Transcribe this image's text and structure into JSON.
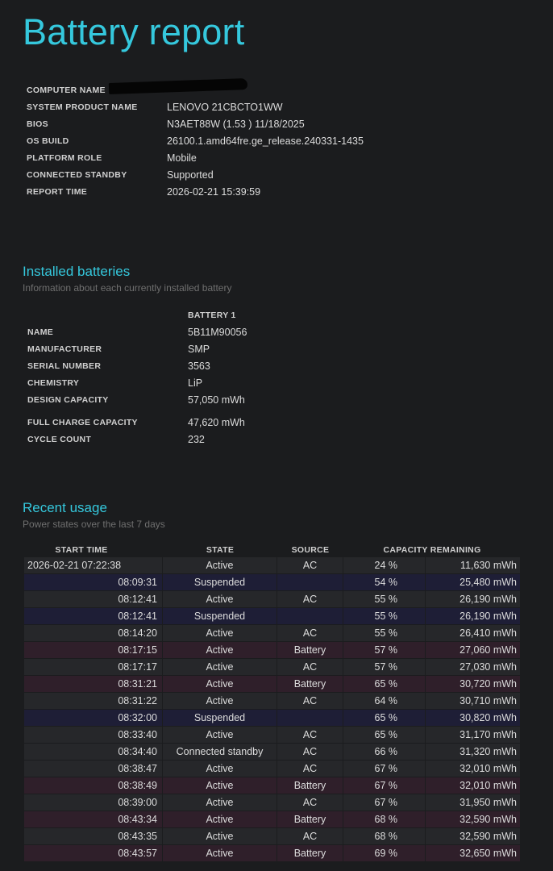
{
  "title": "Battery report",
  "system_info": [
    {
      "label": "COMPUTER NAME",
      "value": ""
    },
    {
      "label": "SYSTEM PRODUCT NAME",
      "value": "LENOVO 21CBCTO1WW"
    },
    {
      "label": "BIOS",
      "value": "N3AET88W (1.53 ) 11/18/2025"
    },
    {
      "label": "OS BUILD",
      "value": "26100.1.amd64fre.ge_release.240331-1435"
    },
    {
      "label": "PLATFORM ROLE",
      "value": "Mobile"
    },
    {
      "label": "CONNECTED STANDBY",
      "value": "Supported"
    },
    {
      "label": "REPORT TIME",
      "value": "2026-02-21  15:39:59"
    }
  ],
  "installed_batteries": {
    "heading": "Installed batteries",
    "subtitle": "Information about each currently installed battery",
    "column_header": "BATTERY 1",
    "rows": [
      {
        "label": "NAME",
        "value": "5B11M90056"
      },
      {
        "label": "MANUFACTURER",
        "value": "SMP"
      },
      {
        "label": "SERIAL NUMBER",
        "value": "3563"
      },
      {
        "label": "CHEMISTRY",
        "value": "LiP"
      },
      {
        "label": "DESIGN CAPACITY",
        "value": "57,050 mWh"
      }
    ],
    "rows2": [
      {
        "label": "FULL CHARGE CAPACITY",
        "value": "47,620 mWh"
      },
      {
        "label": "CYCLE COUNT",
        "value": "232"
      }
    ]
  },
  "recent_usage": {
    "heading": "Recent usage",
    "subtitle": "Power states over the last 7 days",
    "headers": {
      "start_time": "START TIME",
      "state": "STATE",
      "source": "SOURCE",
      "capacity": "CAPACITY REMAINING"
    },
    "rows": [
      {
        "start": "2026-02-21  07:22:38",
        "state": "Active",
        "source": "AC",
        "pct": "24 %",
        "mwh": "11,630 mWh",
        "kind": "ac"
      },
      {
        "start": "08:09:31",
        "state": "Suspended",
        "source": "",
        "pct": "54 %",
        "mwh": "25,480 mWh",
        "kind": "susp"
      },
      {
        "start": "08:12:41",
        "state": "Active",
        "source": "AC",
        "pct": "55 %",
        "mwh": "26,190 mWh",
        "kind": "ac"
      },
      {
        "start": "08:12:41",
        "state": "Suspended",
        "source": "",
        "pct": "55 %",
        "mwh": "26,190 mWh",
        "kind": "susp"
      },
      {
        "start": "08:14:20",
        "state": "Active",
        "source": "AC",
        "pct": "55 %",
        "mwh": "26,410 mWh",
        "kind": "ac"
      },
      {
        "start": "08:17:15",
        "state": "Active",
        "source": "Battery",
        "pct": "57 %",
        "mwh": "27,060 mWh",
        "kind": "batt"
      },
      {
        "start": "08:17:17",
        "state": "Active",
        "source": "AC",
        "pct": "57 %",
        "mwh": "27,030 mWh",
        "kind": "ac"
      },
      {
        "start": "08:31:21",
        "state": "Active",
        "source": "Battery",
        "pct": "65 %",
        "mwh": "30,720 mWh",
        "kind": "batt"
      },
      {
        "start": "08:31:22",
        "state": "Active",
        "source": "AC",
        "pct": "64 %",
        "mwh": "30,710 mWh",
        "kind": "ac"
      },
      {
        "start": "08:32:00",
        "state": "Suspended",
        "source": "",
        "pct": "65 %",
        "mwh": "30,820 mWh",
        "kind": "susp"
      },
      {
        "start": "08:33:40",
        "state": "Active",
        "source": "AC",
        "pct": "65 %",
        "mwh": "31,170 mWh",
        "kind": "ac"
      },
      {
        "start": "08:34:40",
        "state": "Connected standby",
        "source": "AC",
        "pct": "66 %",
        "mwh": "31,320 mWh",
        "kind": "ac"
      },
      {
        "start": "08:38:47",
        "state": "Active",
        "source": "AC",
        "pct": "67 %",
        "mwh": "32,010 mWh",
        "kind": "ac"
      },
      {
        "start": "08:38:49",
        "state": "Active",
        "source": "Battery",
        "pct": "67 %",
        "mwh": "32,010 mWh",
        "kind": "batt"
      },
      {
        "start": "08:39:00",
        "state": "Active",
        "source": "AC",
        "pct": "67 %",
        "mwh": "31,950 mWh",
        "kind": "ac"
      },
      {
        "start": "08:43:34",
        "state": "Active",
        "source": "Battery",
        "pct": "68 %",
        "mwh": "32,590 mWh",
        "kind": "batt"
      },
      {
        "start": "08:43:35",
        "state": "Active",
        "source": "AC",
        "pct": "68 %",
        "mwh": "32,590 mWh",
        "kind": "ac"
      },
      {
        "start": "08:43:57",
        "state": "Active",
        "source": "Battery",
        "pct": "69 %",
        "mwh": "32,650 mWh",
        "kind": "batt"
      }
    ]
  },
  "colors": {
    "accent": "#35c8dd",
    "background": "#1b1c1e",
    "row_ac": "#26272a",
    "row_suspended": "#1e1e36",
    "row_battery": "#2f1f2a"
  }
}
